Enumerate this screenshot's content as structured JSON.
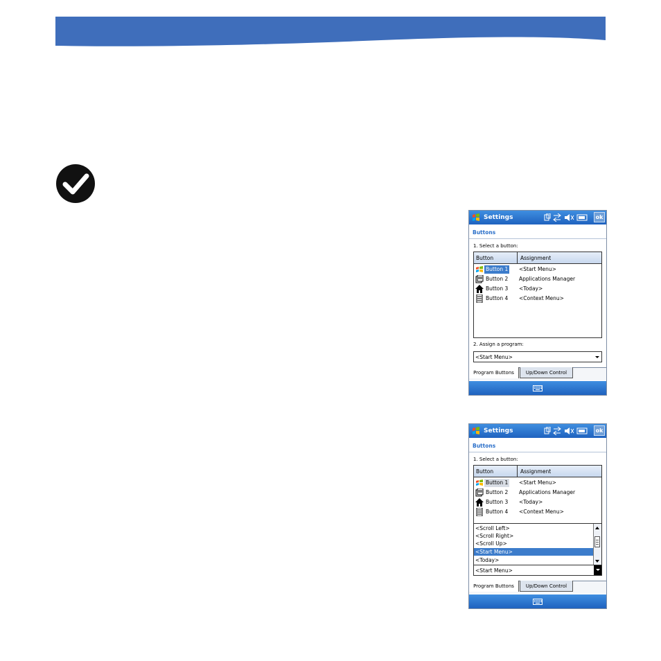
{
  "page": {
    "accent_color": "#3f6ebb",
    "check_icon": "checkmark-circle-icon"
  },
  "screenshots": [
    {
      "window_title": "Settings",
      "ok_label": "ok",
      "heading": "Buttons",
      "select_label": "1. Select a button:",
      "columns": [
        "Button",
        "Assignment"
      ],
      "rows": [
        {
          "icon": "windows-start-icon",
          "button": "Button 1",
          "assignment": "<Start Menu>"
        },
        {
          "icon": "apps-manager-icon",
          "button": "Button 2",
          "assignment": "Applications Manager"
        },
        {
          "icon": "home-icon",
          "button": "Button 3",
          "assignment": "<Today>"
        },
        {
          "icon": "context-menu-icon",
          "button": "Button 4",
          "assignment": "<Context Menu>"
        }
      ],
      "assign_label": "2. Assign a program:",
      "combo_value": "<Start Menu>",
      "tabs": [
        "Program Buttons",
        "Up/Down Control"
      ]
    },
    {
      "window_title": "Settings",
      "ok_label": "ok",
      "heading": "Buttons",
      "select_label": "1. Select a button:",
      "columns": [
        "Button",
        "Assignment"
      ],
      "rows": [
        {
          "icon": "windows-start-icon",
          "button": "Button 1",
          "assignment": "<Start Menu>"
        },
        {
          "icon": "apps-manager-icon",
          "button": "Button 2",
          "assignment": "Applications Manager"
        },
        {
          "icon": "home-icon",
          "button": "Button 3",
          "assignment": "<Today>"
        },
        {
          "icon": "context-menu-icon",
          "button": "Button 4",
          "assignment": "<Context Menu>"
        }
      ],
      "dropdown_items": [
        "<Scroll Left>",
        "<Scroll Right>",
        "<Scroll Up>",
        "<Start Menu>",
        "<Today>"
      ],
      "dropdown_selected": "<Start Menu>",
      "combo_value": "<Start Menu>",
      "tabs": [
        "Program Buttons",
        "Up/Down Control"
      ]
    }
  ]
}
